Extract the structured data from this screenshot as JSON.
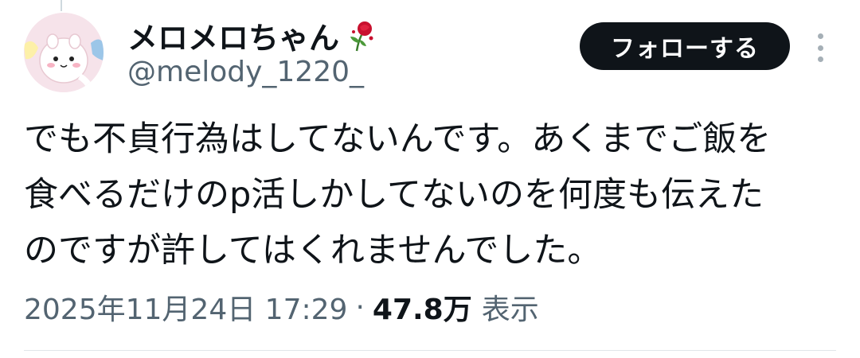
{
  "user": {
    "display_name": "メロメロちゃん",
    "handle": "@melody_1220_"
  },
  "follow_button": {
    "label": "フォローする"
  },
  "tweet": {
    "lines": [
      "でも不貞行為はしてないんです。あくまでご飯を",
      "食べるだけのp活しかしてないのを何度も伝えた",
      "のですが許してはくれませんでした。"
    ]
  },
  "meta": {
    "timestamp": "2025年11月24日 17:29",
    "separator": "·",
    "views_count": "47.8万",
    "views_label": "表示"
  },
  "icons": {
    "rose": "rose-icon",
    "more": "more-vertical-icon"
  },
  "colors": {
    "text_primary": "#0f1419",
    "text_secondary": "#536471",
    "button_bg": "#0f1419",
    "button_text": "#ffffff"
  }
}
